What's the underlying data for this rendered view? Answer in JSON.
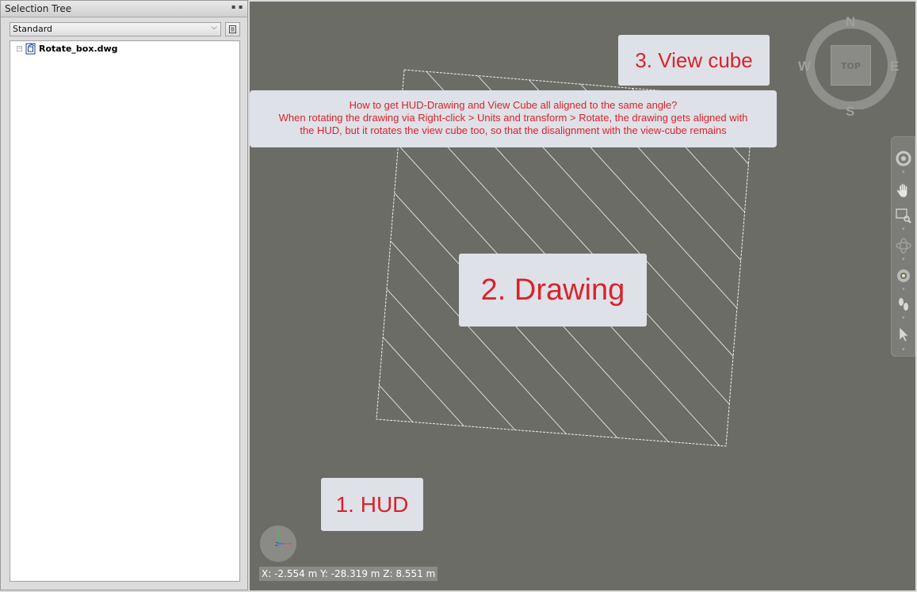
{
  "panel": {
    "title": "Selection Tree",
    "dropdown_value": "Standard",
    "tree_items": [
      {
        "label": "Rotate_box.dwg"
      }
    ]
  },
  "viewport": {
    "annotations": {
      "drawing": "2. Drawing",
      "view_cube": "3. View cube",
      "hud": "1. HUD"
    },
    "question_lines": [
      "How to get HUD-Drawing and View Cube all aligned to the same angle?",
      "When rotating the drawing via Right-click > Units and transform > Rotate, the drawing gets aligned with",
      "the HUD, but it rotates the view cube too, so that the disalignment with the view-cube remains"
    ],
    "view_cube": {
      "face_label": "TOP",
      "north": "N",
      "south": "S",
      "east": "E",
      "west": "W"
    },
    "hud_axis_label": "Z",
    "coordinates": "X: -2.554 m  Y: -28.319 m  Z: 8.551 m"
  },
  "colors": {
    "viewport_bg": "#6b6c66",
    "annotation_text": "#d9232c",
    "annotation_bg": "#dfe1e8",
    "arrow": "#f06a1c"
  },
  "icons": [
    "pin-icon",
    "close-icon",
    "chevron-down-icon",
    "list-icon",
    "file-icon",
    "steering-wheel-icon",
    "hand-pan-icon",
    "zoom-icon",
    "orbit-icon",
    "look-icon",
    "walk-icon",
    "select-cursor-icon"
  ]
}
